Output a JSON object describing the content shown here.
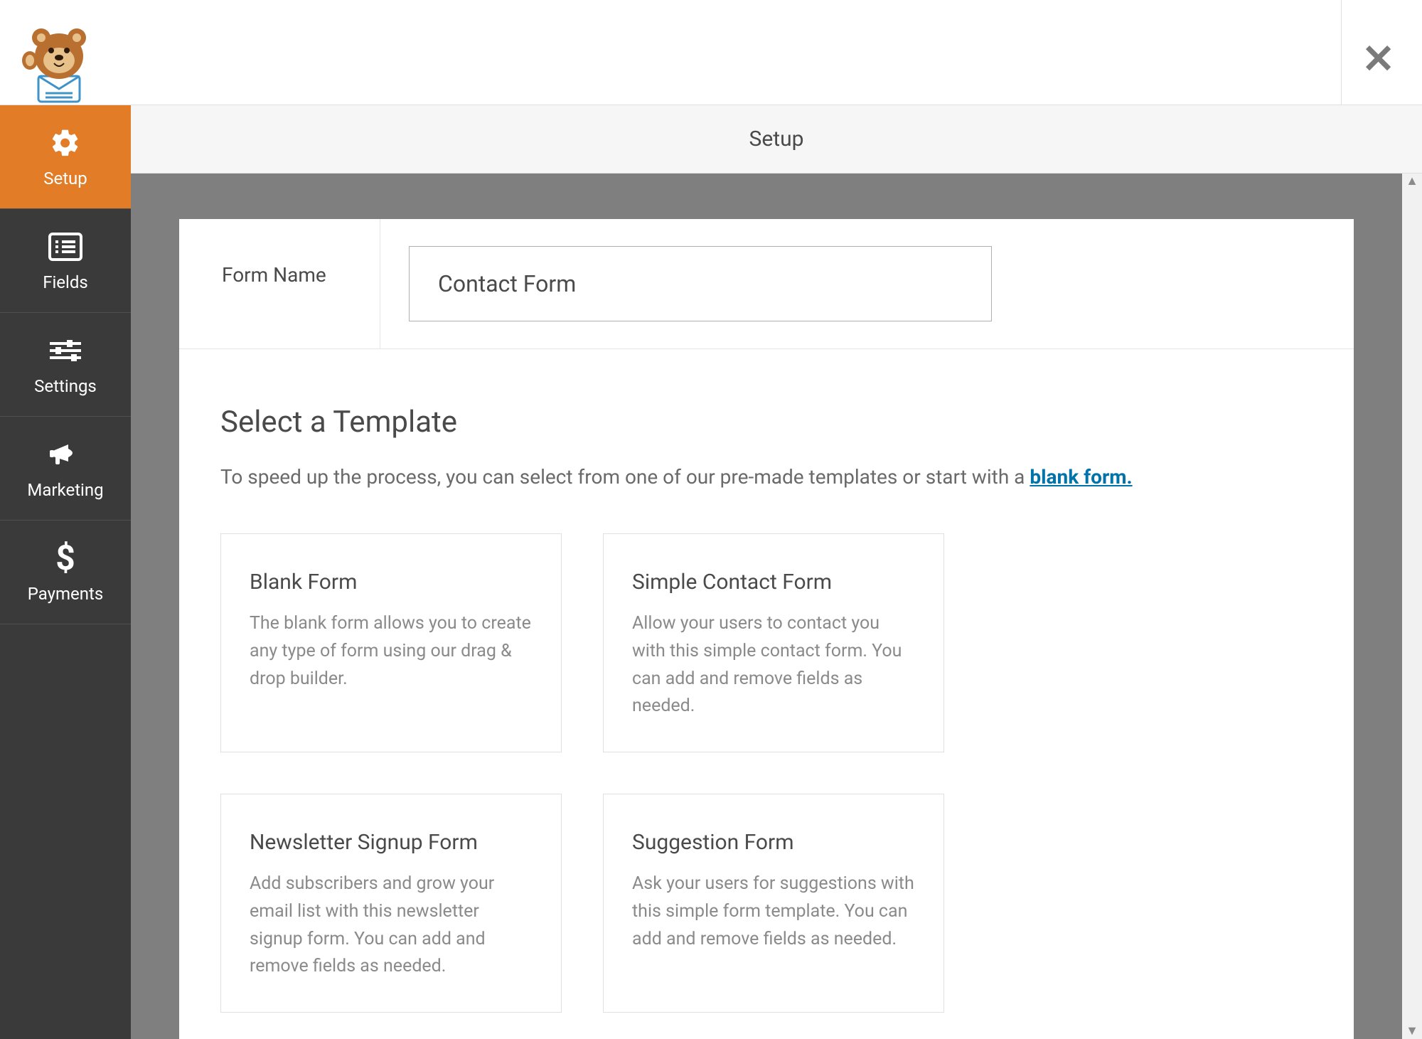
{
  "sidebar": {
    "items": [
      {
        "label": "Setup"
      },
      {
        "label": "Fields"
      },
      {
        "label": "Settings"
      },
      {
        "label": "Marketing"
      },
      {
        "label": "Payments"
      }
    ]
  },
  "page": {
    "title": "Setup"
  },
  "formName": {
    "label": "Form Name",
    "value": "Contact Form"
  },
  "templates": {
    "heading": "Select a Template",
    "introPrefix": "To speed up the process, you can select from one of our pre-made templates or start with a ",
    "blankLink": "blank form.",
    "cards": [
      {
        "title": "Blank Form",
        "desc": "The blank form allows you to create any type of form using our drag & drop builder."
      },
      {
        "title": "Simple Contact Form",
        "desc": "Allow your users to contact you with this simple contact form. You can add and remove fields as needed."
      },
      {
        "title": "Newsletter Signup Form",
        "desc": "Add subscribers and grow your email list with this newsletter signup form. You can add and remove fields as needed."
      },
      {
        "title": "Suggestion Form",
        "desc": "Ask your users for suggestions with this simple form template. You can add and remove fields as needed."
      }
    ]
  }
}
